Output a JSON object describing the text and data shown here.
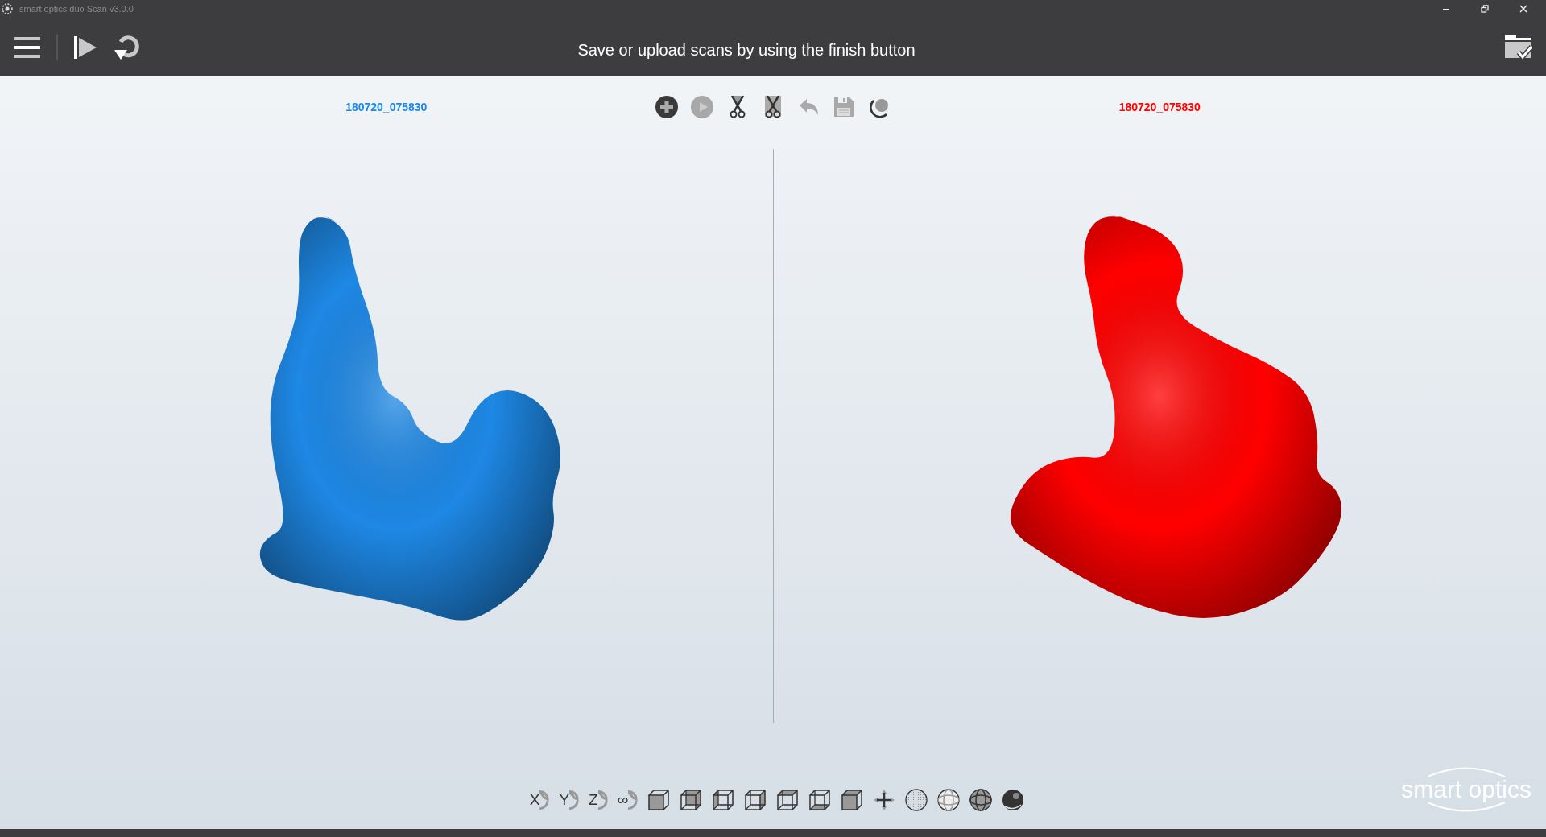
{
  "window": {
    "title": "smart optics duo Scan v3.0.0"
  },
  "header": {
    "message": "Save or upload scans by using the finish button"
  },
  "views": [
    {
      "label": "180720_075830",
      "color": "#1e88e5"
    },
    {
      "label": "180720_075830",
      "color": "#ff0000"
    }
  ],
  "rotate_buttons": [
    {
      "label": "X"
    },
    {
      "label": "Y"
    },
    {
      "label": "Z"
    },
    {
      "label": "∞"
    }
  ],
  "logo": {
    "text": "smart optics"
  }
}
